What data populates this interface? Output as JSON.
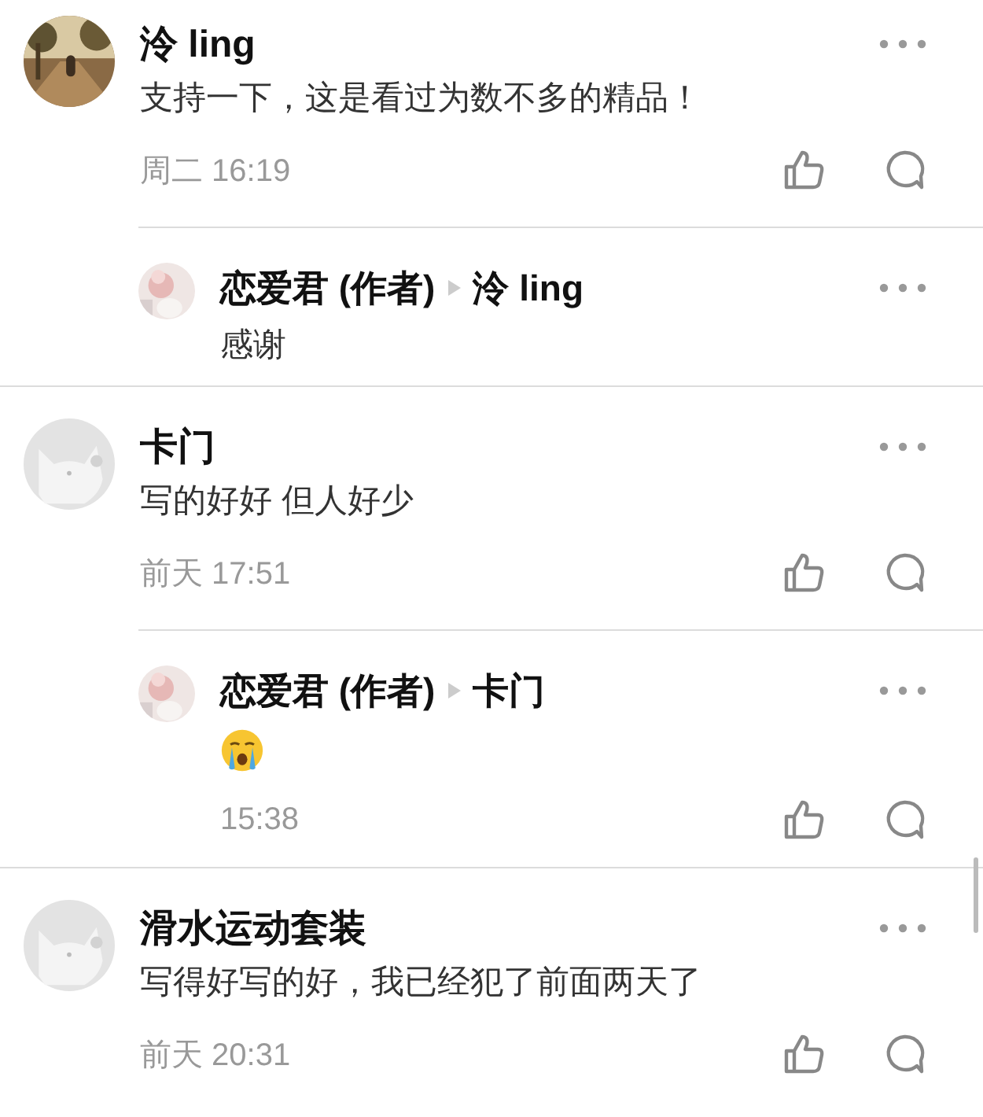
{
  "comments": [
    {
      "name": "泠 ling",
      "text": "支持一下，这是看过为数不多的精品！",
      "time": "周二 16:19",
      "replies": [
        {
          "author": "恋爱君 (作者)",
          "to": "泠 ling",
          "body": {
            "kind": "text",
            "text": "感谢"
          }
        }
      ]
    },
    {
      "avatar": {
        "kind": "default"
      },
      "name": "卡门",
      "text": "写的好好 但人好少",
      "time": "前天 17:51",
      "replies": [
        {
          "author": "恋爱君 (作者)",
          "to": "卡门",
          "body": {
            "kind": "emoji"
          },
          "time": "15:38"
        }
      ]
    },
    {
      "avatar": {
        "kind": "default"
      },
      "name": "滑水运动套装",
      "text": "写得好写的好，我已经犯了前面两天了",
      "time": "前天 20:31"
    }
  ]
}
